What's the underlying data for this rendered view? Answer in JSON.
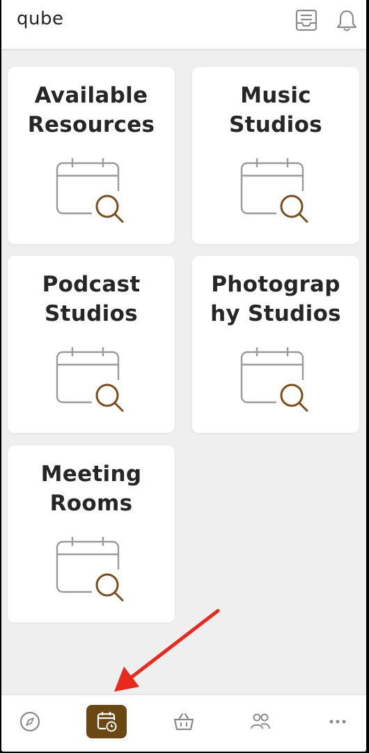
{
  "header": {
    "logo_text": "qube",
    "icons": [
      "inbox-icon",
      "bell-icon"
    ]
  },
  "cards": [
    {
      "title_line1": "Available",
      "title_line2": "Resources",
      "icon": "calendar-search-icon"
    },
    {
      "title_line1": "Music",
      "title_line2": "Studios",
      "icon": "calendar-search-icon"
    },
    {
      "title_line1": "Podcast",
      "title_line2": "Studios",
      "icon": "calendar-search-icon"
    },
    {
      "title_line1": "Photograp",
      "title_line2": "hy Studios",
      "icon": "calendar-search-icon"
    },
    {
      "title_line1": "Meeting",
      "title_line2": "Rooms",
      "icon": "calendar-search-icon"
    }
  ],
  "bottom_nav": {
    "items": [
      "compass-icon",
      "calendar-clock-icon",
      "basket-icon",
      "people-icon",
      "more-icon"
    ],
    "active": "calendar-clock-icon"
  },
  "colors": {
    "accent": "#6b4714",
    "magnifier": "#7a4e1c",
    "annotation_arrow": "#e8291c",
    "background": "#efefef"
  }
}
